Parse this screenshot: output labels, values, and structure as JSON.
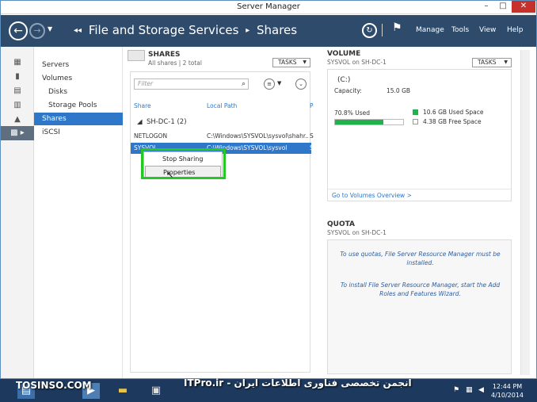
{
  "window": {
    "title": "Server Manager",
    "min": "–",
    "max": "□",
    "close": "✕"
  },
  "nav": {
    "back_glyph": "←",
    "fwd_glyph": "→",
    "crumb_glyph": "◂◂",
    "crumb_sep": "▸",
    "breadcrumb": [
      "File and Storage Services",
      "Shares"
    ],
    "refresh_glyph": "↻",
    "flag_glyph": "⚑",
    "menus": [
      "Manage",
      "Tools",
      "View",
      "Help"
    ]
  },
  "rail": {
    "icons": [
      "dashboard-icon",
      "local-server-icon",
      "all-servers-icon",
      "roles-icon",
      "storage-icon",
      "file-services-icon"
    ]
  },
  "sidebar": {
    "items": [
      {
        "label": "Servers",
        "indent": false,
        "active": false
      },
      {
        "label": "Volumes",
        "indent": false,
        "active": false
      },
      {
        "label": "Disks",
        "indent": true,
        "active": false
      },
      {
        "label": "Storage Pools",
        "indent": true,
        "active": false
      },
      {
        "label": "Shares",
        "indent": false,
        "active": true
      },
      {
        "label": "iSCSI",
        "indent": false,
        "active": false
      }
    ]
  },
  "shares": {
    "title": "SHARES",
    "subtitle": "All shares | 2 total",
    "tasks_label": "TASKS",
    "filter_placeholder": "Filter",
    "columns": [
      "Share",
      "Local Path",
      "P"
    ],
    "group": "SH-DC-1 (2)",
    "rows": [
      {
        "share": "NETLOGON",
        "path": "C:\\Windows\\SYSVOL\\sysvol\\shahr...",
        "p": "S",
        "selected": false
      },
      {
        "share": "SYSVOL",
        "path": "C:\\Windows\\SYSVOL\\sysvol",
        "p": "S",
        "selected": true
      }
    ]
  },
  "context_menu": {
    "items": [
      "Stop Sharing",
      "Properties"
    ]
  },
  "volume": {
    "title": "VOLUME",
    "subtitle": "SYSVOL on SH-DC-1",
    "tasks_label": "TASKS",
    "drive": "(C:)",
    "capacity_label": "Capacity:",
    "capacity_value": "15.0 GB",
    "used_pct_label": "70.8% Used",
    "used_fraction": 0.708,
    "used_space": "10.6 GB Used Space",
    "free_space": "4.38 GB Free Space",
    "overview_link": "Go to Volumes Overview >",
    "used_color": "#22b14c"
  },
  "quota": {
    "title": "QUOTA",
    "subtitle": "SYSVOL on SH-DC-1",
    "msg1": "To use quotas, File Server Resource Manager must be installed.",
    "msg2": "To install File Server Resource Manager, start the Add Roles and Features Wizard."
  },
  "taskbar": {
    "watermark_left": "TOSINSO.COM",
    "watermark_right": "انجمن تخصصی فناوری اطلاعات ایران - ITPro.ir",
    "time": "12:44 PM",
    "date": "4/10/2014"
  }
}
